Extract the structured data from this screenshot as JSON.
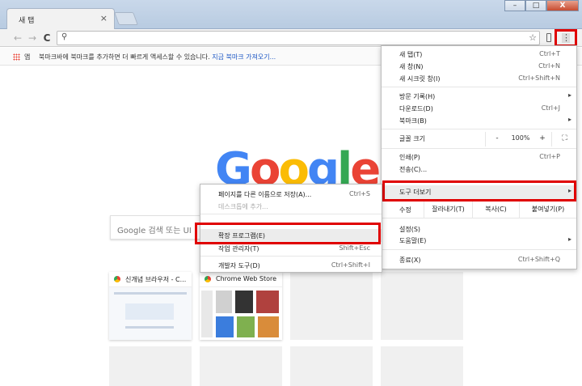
{
  "window": {
    "tab_title": "새 탭",
    "tab_close": "×",
    "minimize": "–",
    "maximize": "□",
    "close": "X"
  },
  "toolbar": {
    "back": "←",
    "forward": "→",
    "reload": "C",
    "search_icon": "⚲",
    "star": "☆",
    "menu_icon": "⋮"
  },
  "bookmarks": {
    "apps_label": "앱",
    "hint": "북마크바에 북마크를 추가하면 더 빠르게 액세스할 수 있습니다. ",
    "import_link": "지금 북마크 가져오기..."
  },
  "content": {
    "logo_letters": [
      "G",
      "o",
      "o",
      "g",
      "l",
      "e"
    ],
    "logo_colors": [
      "#4285F4",
      "#EA4335",
      "#FBBC05",
      "#4285F4",
      "#34A853",
      "#EA4335"
    ],
    "search_placeholder": "Google 검색 또는 UI",
    "tiles": [
      {
        "title": "신개념 브라우저 - C..."
      },
      {
        "title": "Chrome Web Store"
      }
    ]
  },
  "menu": {
    "new_tab": {
      "label": "새 탭(T)",
      "shortcut": "Ctrl+T"
    },
    "new_window": {
      "label": "새 창(N)",
      "shortcut": "Ctrl+N"
    },
    "incognito": {
      "label": "새 시크릿 창(I)",
      "shortcut": "Ctrl+Shift+N"
    },
    "history": {
      "label": "방문 기록(H)",
      "arrow": "▸"
    },
    "downloads": {
      "label": "다운로드(D)",
      "shortcut": "Ctrl+J"
    },
    "bookmarks": {
      "label": "북마크(B)",
      "arrow": "▸"
    },
    "zoom": {
      "label": "글꼴 크기",
      "minus": "-",
      "value": "100%",
      "plus": "+",
      "fullscreen": "⛶"
    },
    "print": {
      "label": "인쇄(P)",
      "shortcut": "Ctrl+P"
    },
    "cast": {
      "label": "전송(C)..."
    },
    "more_tools": {
      "label": "도구 더보기",
      "arrow": "▸"
    },
    "edit": {
      "label": "수정",
      "cut": "잘라내기(T)",
      "copy": "복사(C)",
      "paste": "붙여넣기(P)"
    },
    "settings": {
      "label": "설정(S)"
    },
    "help": {
      "label": "도움말(E)",
      "arrow": "▸"
    },
    "exit": {
      "label": "종료(X)",
      "shortcut": "Ctrl+Shift+Q"
    }
  },
  "submenu": {
    "save_page": {
      "label": "페이지를 다른 이름으로 저장(A)...",
      "shortcut": "Ctrl+S"
    },
    "add_to_desktop": {
      "label": "데스크톱에 추가..."
    },
    "extensions": {
      "label": "확장 프로그램(E)"
    },
    "task_manager": {
      "label": "작업 관리자(T)",
      "shortcut": "Shift+Esc"
    },
    "dev_tools": {
      "label": "개발자 도구(D)",
      "shortcut": "Ctrl+Shift+I"
    }
  }
}
